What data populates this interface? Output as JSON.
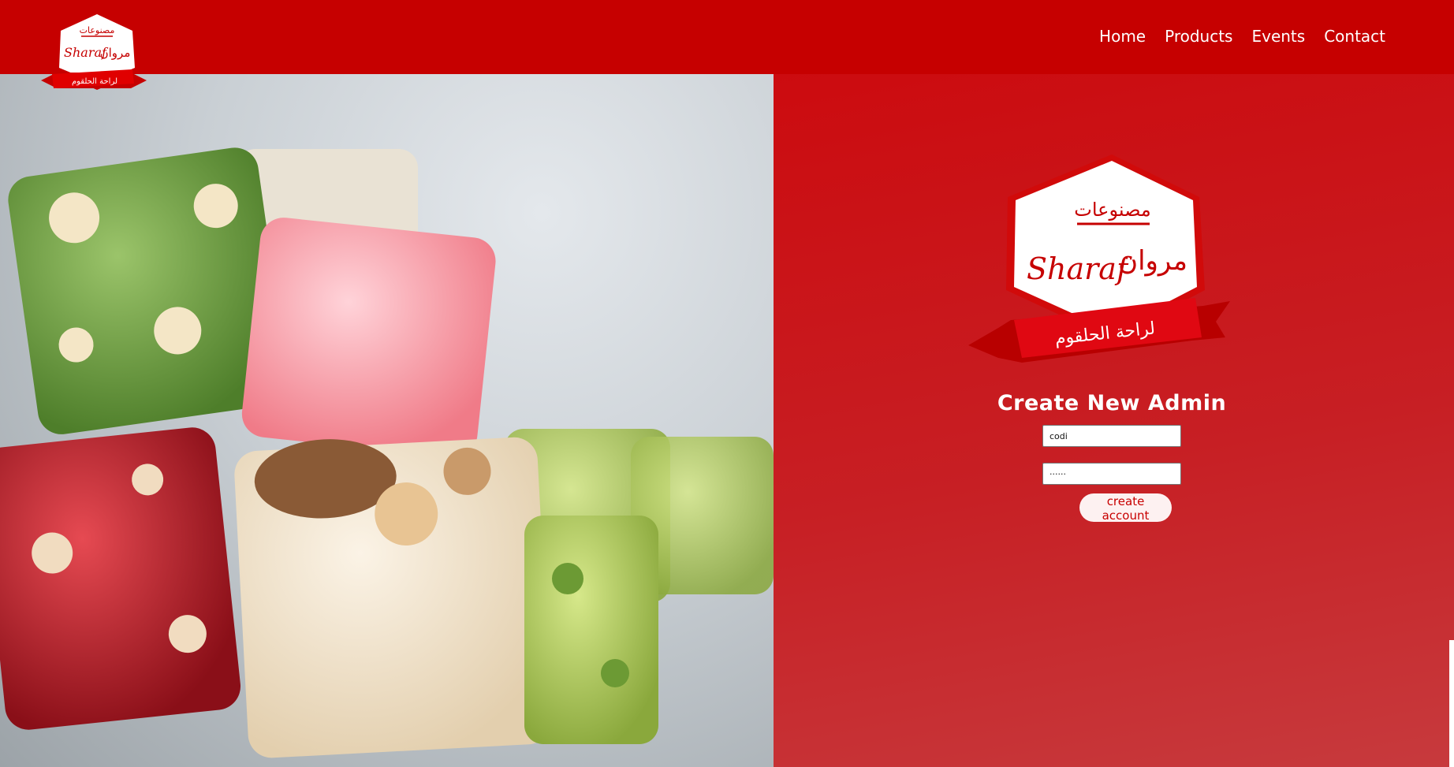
{
  "nav": {
    "links": [
      "Home",
      "Products",
      "Events",
      "Contact"
    ]
  },
  "logo": {
    "top_text": "مصنوعات",
    "brand_latin": "Sharaf",
    "brand_arabic": "مروان",
    "ribbon_text": "لراحة الحلقوم"
  },
  "hero": {
    "image_name": "turkish-delight-photo"
  },
  "form": {
    "title": "Create New Admin",
    "username_value": "codi",
    "password_value": "······",
    "submit_label": "create account"
  },
  "colors": {
    "brand_red": "#c60000",
    "panel_red": "#c71f24",
    "button_bg": "#fdf1f1"
  }
}
